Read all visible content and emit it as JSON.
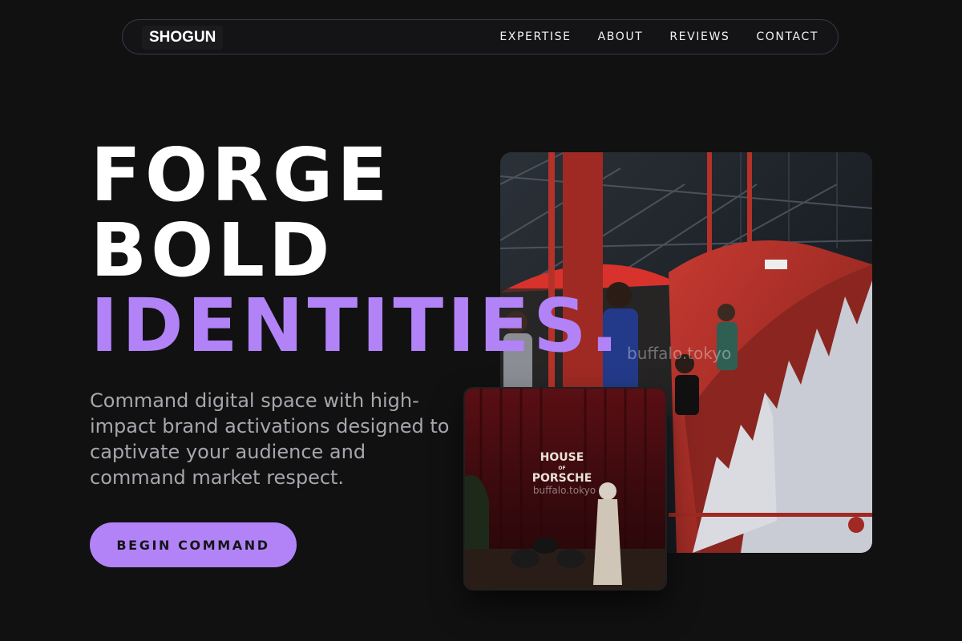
{
  "nav": {
    "logo": "SHOGUN",
    "links": [
      "EXPERTISE",
      "ABOUT",
      "REVIEWS",
      "CONTACT"
    ]
  },
  "hero": {
    "line1": "FORGE",
    "line2": "BOLD",
    "line3": "IDENTITIES.",
    "subtitle": "Command digital space with high-impact brand activations designed to captivate your audience and command market respect.",
    "cta": "BEGIN COMMAND"
  },
  "images": {
    "main_watermark": "buffalo.tokyo",
    "small_sign_line1": "HOUSE",
    "small_sign_line2": "OF",
    "small_sign_line3": "PORSCHE",
    "small_watermark": "buffalo.tokyo"
  },
  "colors": {
    "background": "#111112",
    "accent": "#b283f7",
    "text": "#ffffff",
    "muted": "#a6a6ad"
  }
}
